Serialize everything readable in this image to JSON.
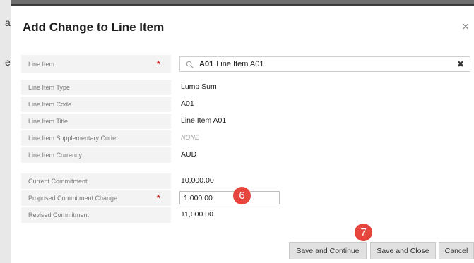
{
  "background": {
    "chars": [
      "a",
      "e",
      "e"
    ]
  },
  "dialog": {
    "title": "Add Change to Line Item",
    "close_glyph": "×"
  },
  "fields": {
    "line_item": {
      "label": "Line Item",
      "required_mark": "*",
      "code": "A01",
      "text": "Line Item A01",
      "clear_glyph": "✖"
    },
    "line_item_type": {
      "label": "Line Item Type",
      "value": "Lump Sum"
    },
    "line_item_code": {
      "label": "Line Item Code",
      "value": "A01"
    },
    "line_item_title": {
      "label": "Line Item Title",
      "value": "Line Item A01"
    },
    "supplementary_code": {
      "label": "Line Item Supplementary Code",
      "value": "NONE"
    },
    "currency": {
      "label": "Line Item Currency",
      "value": "AUD"
    },
    "current_commitment": {
      "label": "Current Commitment",
      "value": "10,000.00"
    },
    "proposed_change": {
      "label": "Proposed Commitment Change",
      "required_mark": "*",
      "value": "1,000.00"
    },
    "revised_commitment": {
      "label": "Revised Commitment",
      "value": "11,000.00"
    }
  },
  "annotations": {
    "step_6": "6",
    "step_7": "7"
  },
  "buttons": {
    "save_continue": "Save and Continue",
    "save_close": "Save and Close",
    "cancel": "Cancel"
  },
  "colors": {
    "badge": "#e5453d",
    "required": "#d21f1f",
    "label_bg": "#f3f3f3"
  }
}
